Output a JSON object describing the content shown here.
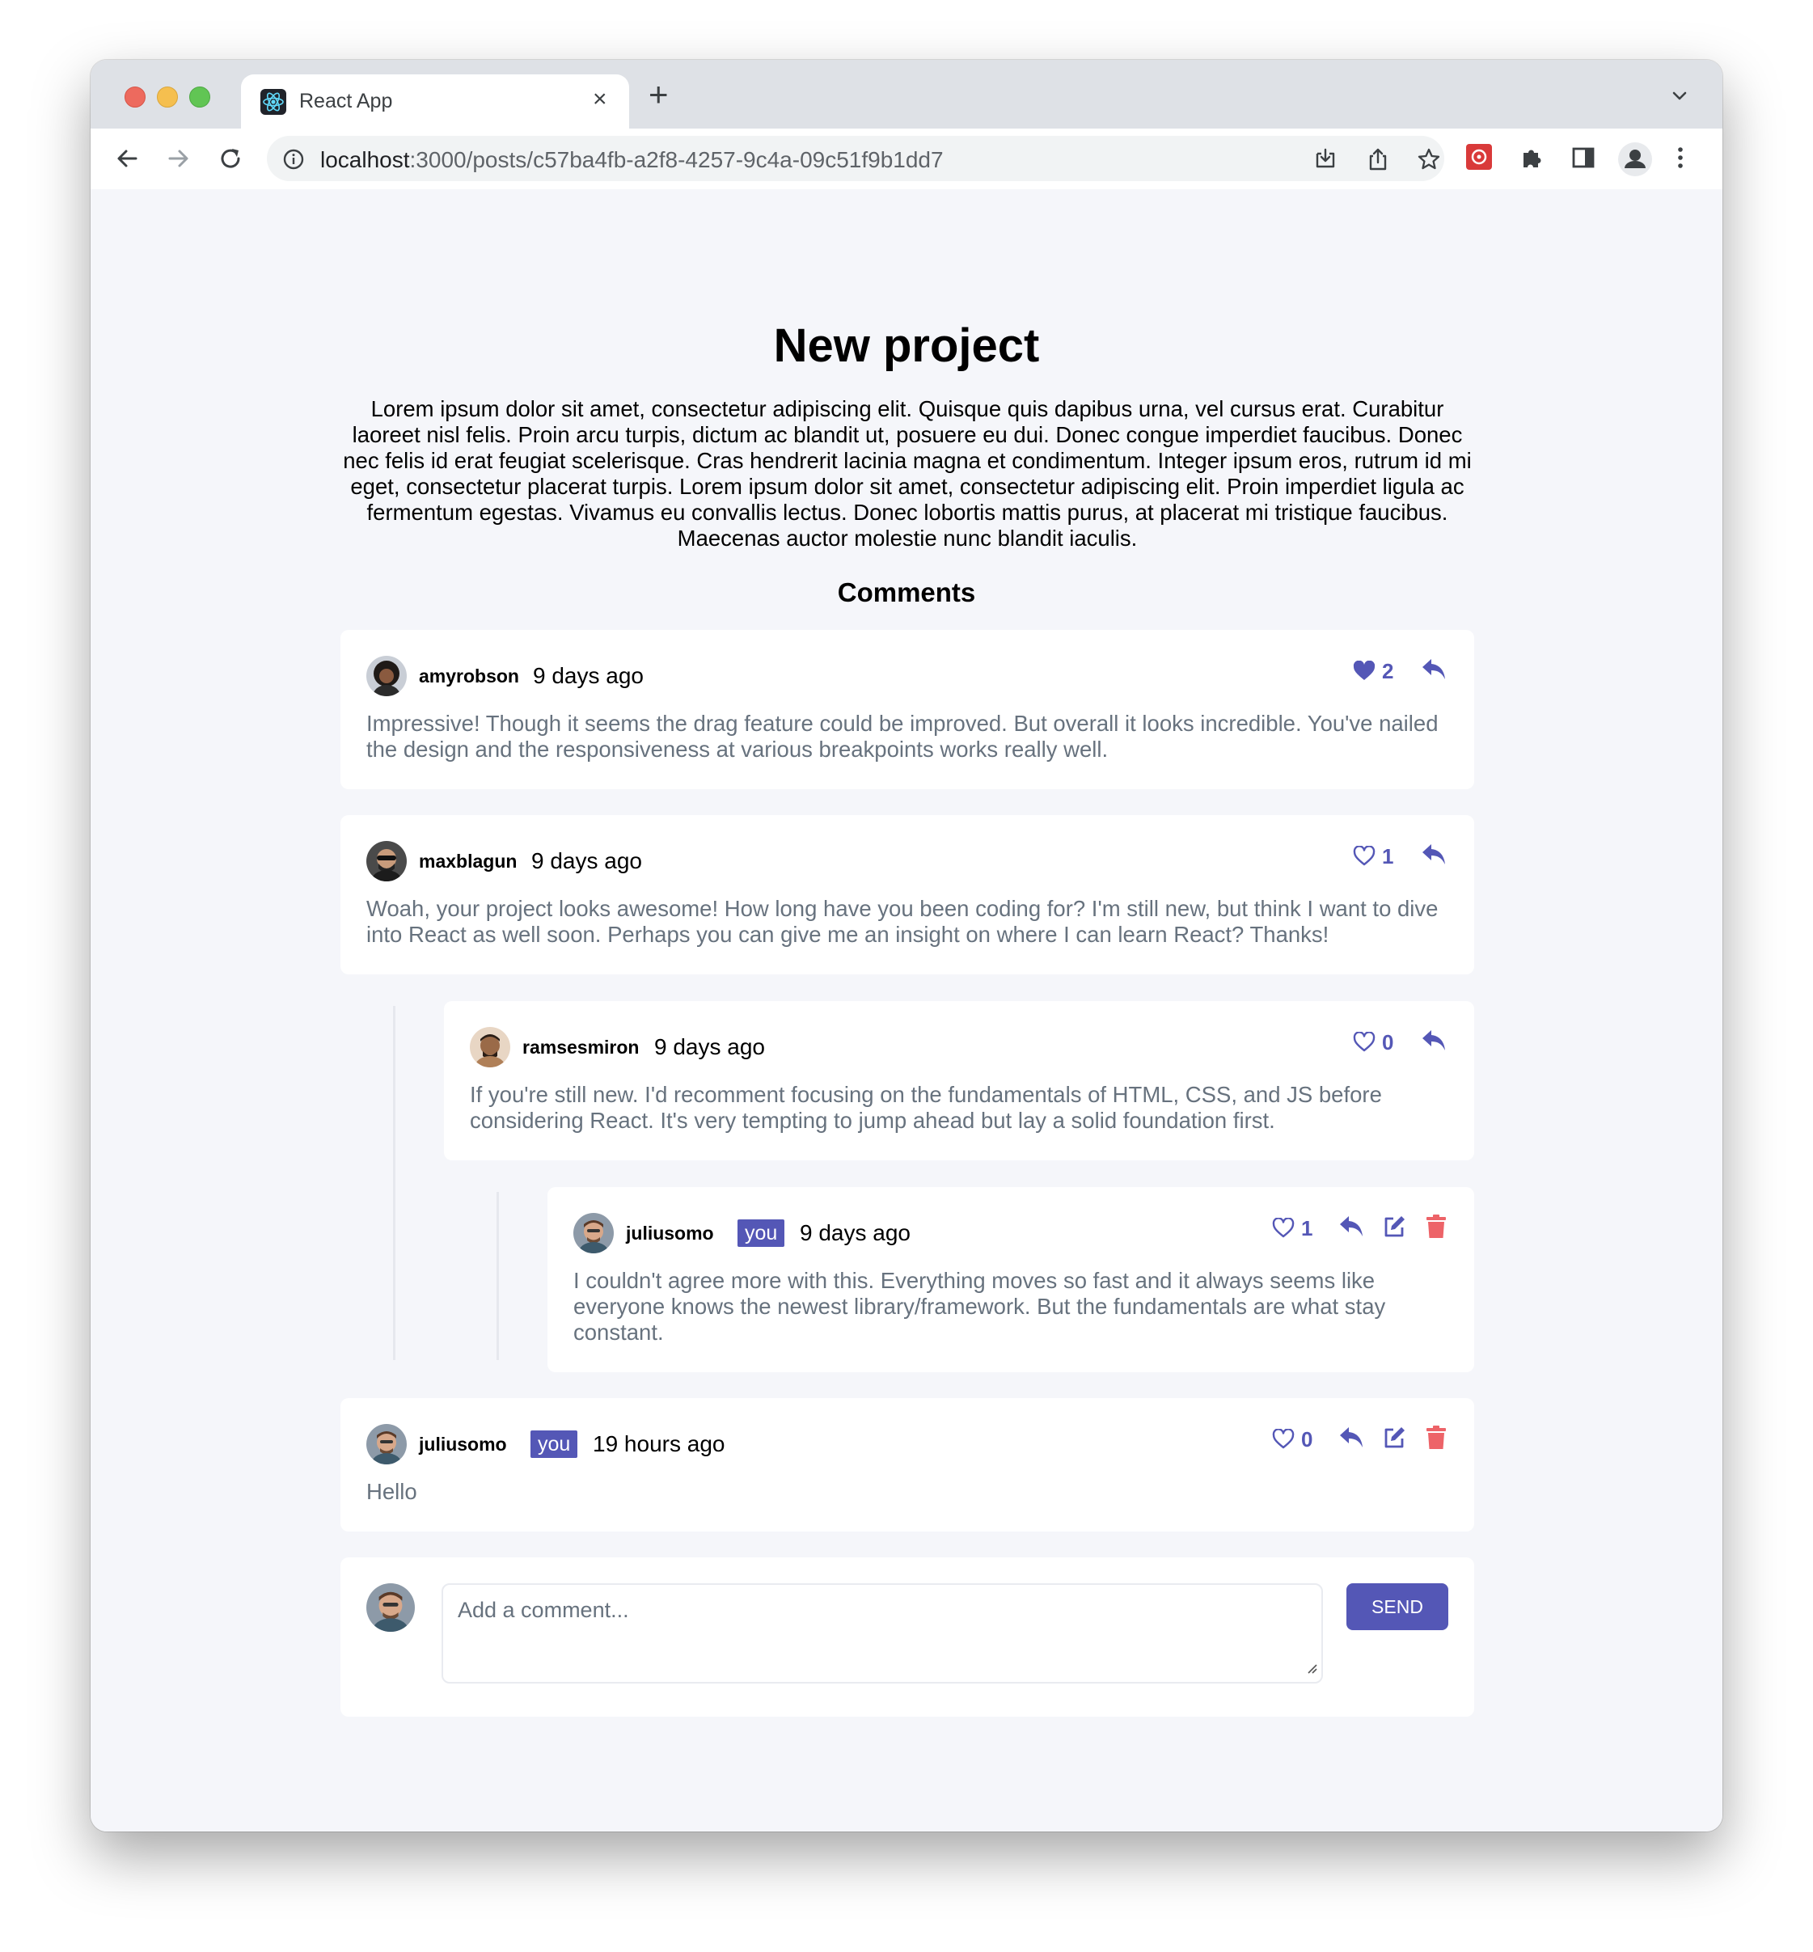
{
  "browser": {
    "tab_title": "React App",
    "tab_close": "×",
    "new_tab": "+",
    "url_host": "localhost",
    "url_path": ":3000/posts/c57ba4fb-a2f8-4257-9c4a-09c51f9b1dd7"
  },
  "post": {
    "title": "New project",
    "body": "Lorem ipsum dolor sit amet, consectetur adipiscing elit. Quisque quis dapibus urna, vel cursus erat. Curabitur laoreet nisl felis. Proin arcu turpis, dictum ac blandit ut, posuere eu dui. Donec congue imperdiet faucibus. Donec nec felis id erat feugiat scelerisque. Cras hendrerit lacinia magna et condimentum. Integer ipsum eros, rutrum id mi eget, consectetur placerat turpis. Lorem ipsum dolor sit amet, consectetur adipiscing elit. Proin imperdiet ligula ac fermentum egestas. Vivamus eu convallis lectus. Donec lobortis mattis purus, at placerat mi tristique faucibus. Maecenas auctor molestie nunc blandit iaculis."
  },
  "comments_heading": "Comments",
  "you_label": "you",
  "comments": [
    {
      "username": "amyrobson",
      "time": "9 days ago",
      "likes": "2",
      "liked": true,
      "text": "Impressive! Though it seems the drag feature could be improved. But overall it looks incredible. You've nailed the design and the responsiveness at various breakpoints works really well."
    },
    {
      "username": "maxblagun",
      "time": "9 days ago",
      "likes": "1",
      "liked": false,
      "text": "Woah, your project looks awesome! How long have you been coding for? I'm still new, but think I want to dive into React as well soon. Perhaps you can give me an insight on where I can learn React? Thanks!"
    },
    {
      "username": "ramsesmiron",
      "time": "9 days ago",
      "likes": "0",
      "liked": false,
      "text": "If you're still new. I'd recomment focusing on the fundamentals of HTML, CSS, and JS before considering React. It's very tempting to jump ahead but lay a solid foundation first."
    },
    {
      "username": "juliusomo",
      "time": "9 days ago",
      "likes": "1",
      "liked": false,
      "text": "I couldn't agree more with this. Everything moves so fast and it always seems like everyone knows the newest library/framework. But the fundamentals are what stay constant."
    },
    {
      "username": "juliusomo",
      "time": "19 hours ago",
      "likes": "0",
      "liked": false,
      "text": "Hello"
    }
  ],
  "new_comment": {
    "placeholder": "Add a comment...",
    "send_label": "SEND"
  },
  "colors": {
    "accent": "#5457b6",
    "danger": "#ed6368",
    "text_muted": "#67727e",
    "background": "#f5f6fa"
  }
}
